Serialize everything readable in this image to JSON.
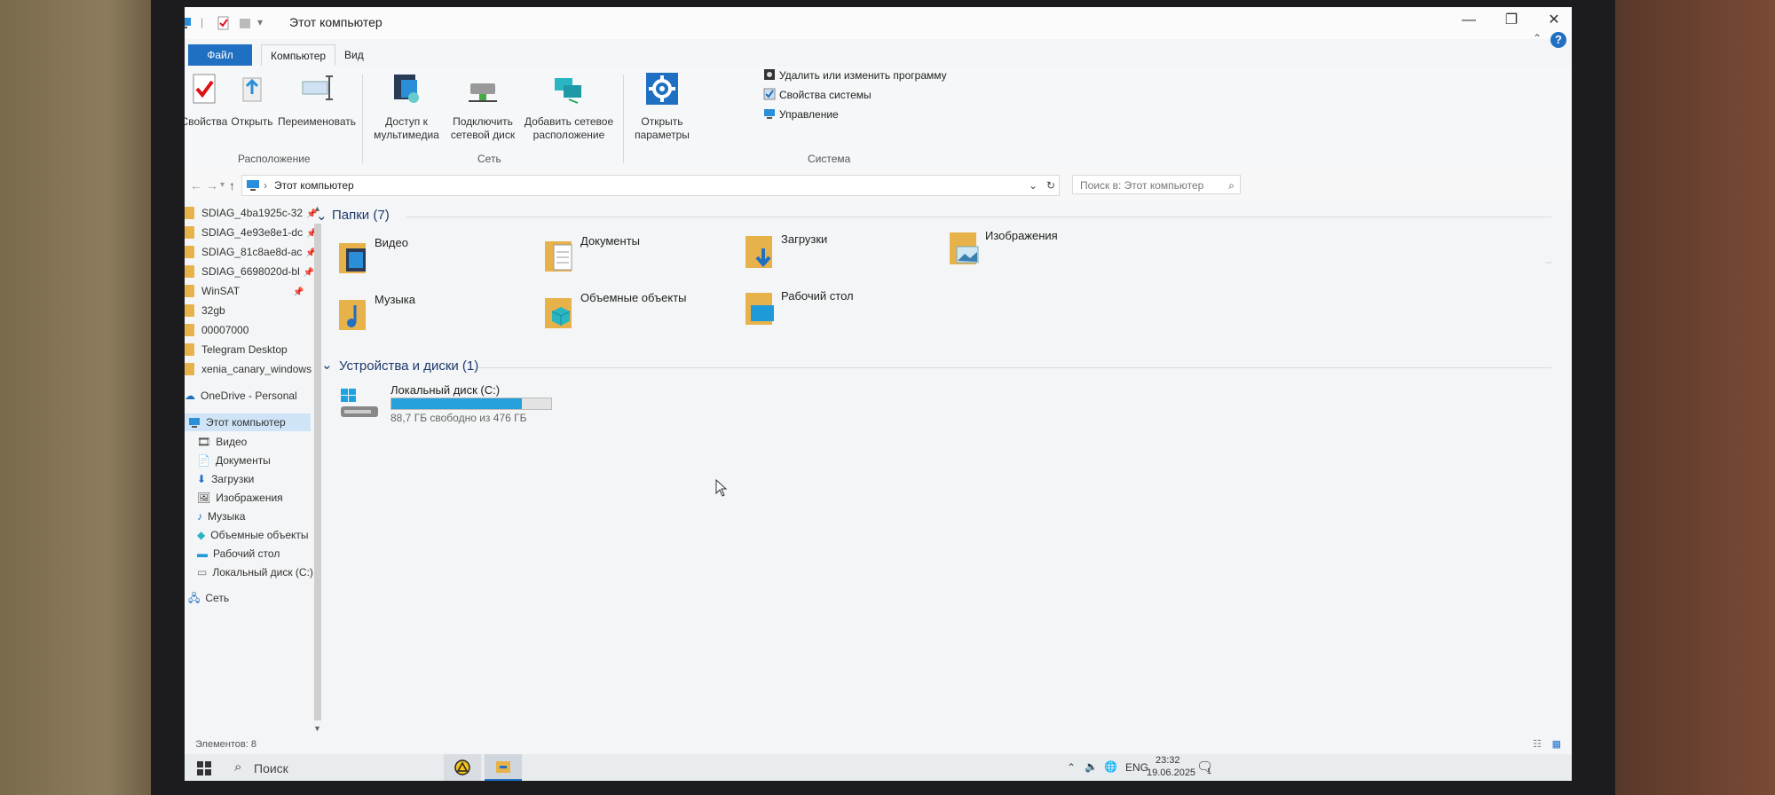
{
  "window": {
    "title": "Этот компьютер",
    "controls": {
      "minimize": "—",
      "maximize": "❐",
      "close": "✕"
    }
  },
  "ribbon": {
    "tabs": [
      {
        "label": "Файл"
      },
      {
        "label": "Компьютер"
      },
      {
        "label": "Вид"
      }
    ],
    "help": "?",
    "collapse": "⌃",
    "groups": {
      "location": {
        "label": "Расположение",
        "buttons": [
          {
            "label": "Свойства"
          },
          {
            "label": "Открыть"
          },
          {
            "label": "Переименовать"
          }
        ]
      },
      "network": {
        "label": "Сеть",
        "buttons": [
          {
            "label1": "Доступ к",
            "label2": "мультимедиа"
          },
          {
            "label1": "Подключить",
            "label2": "сетевой диск"
          },
          {
            "label1": "Добавить сетевое",
            "label2": "расположение"
          }
        ]
      },
      "system": {
        "label": "Система",
        "open_settings": {
          "label1": "Открыть",
          "label2": "параметры"
        },
        "commands": [
          {
            "label": "Удалить или изменить программу"
          },
          {
            "label": "Свойства системы"
          },
          {
            "label": "Управление"
          }
        ]
      }
    }
  },
  "address": {
    "path": "Этот компьютер",
    "search_placeholder": "Поиск в: Этот компьютер"
  },
  "nav_pane": {
    "quick": [
      {
        "label": "SDIAG_4ba1925c-32"
      },
      {
        "label": "SDIAG_4e93e8e1-dc"
      },
      {
        "label": "SDIAG_81c8ae8d-ac"
      },
      {
        "label": "SDIAG_6698020d-bl"
      },
      {
        "label": "WinSAT"
      },
      {
        "label": "32gb"
      },
      {
        "label": "00007000"
      },
      {
        "label": "Telegram Desktop"
      },
      {
        "label": "xenia_canary_windows"
      }
    ],
    "onedrive": "OneDrive - Personal",
    "this_pc": "Этот компьютер",
    "pc_children": [
      {
        "label": "Видео"
      },
      {
        "label": "Документы"
      },
      {
        "label": "Загрузки"
      },
      {
        "label": "Изображения"
      },
      {
        "label": "Музыка"
      },
      {
        "label": "Объемные объекты"
      },
      {
        "label": "Рабочий стол"
      },
      {
        "label": "Локальный диск (C:)"
      }
    ],
    "network": "Сеть"
  },
  "content": {
    "folders_header": "Папки (7)",
    "folders": [
      {
        "label": "Видео",
        "icon": "video-folder-icon"
      },
      {
        "label": "Документы",
        "icon": "documents-folder-icon"
      },
      {
        "label": "Загрузки",
        "icon": "downloads-folder-icon"
      },
      {
        "label": "Изображения",
        "icon": "pictures-folder-icon"
      },
      {
        "label": "Музыка",
        "icon": "music-folder-icon"
      },
      {
        "label": "Объемные объекты",
        "icon": "3d-objects-folder-icon"
      },
      {
        "label": "Рабочий стол",
        "icon": "desktop-folder-icon"
      }
    ],
    "devices_header": "Устройства и диски (1)",
    "drive": {
      "label": "Локальный диск (C:)",
      "free_text": "88,7 ГБ свободно из 476 ГБ",
      "used_fraction": 0.814
    }
  },
  "status": {
    "items": "Элементов: 8"
  },
  "taskbar": {
    "search": "Поиск",
    "lang": "ENG",
    "time": "23:32",
    "date": "19.06.2025",
    "notif_count": "1"
  },
  "colors": {
    "accent": "#1f6fc2",
    "folder": "#e8b24b",
    "drive_bar": "#26a0da"
  }
}
